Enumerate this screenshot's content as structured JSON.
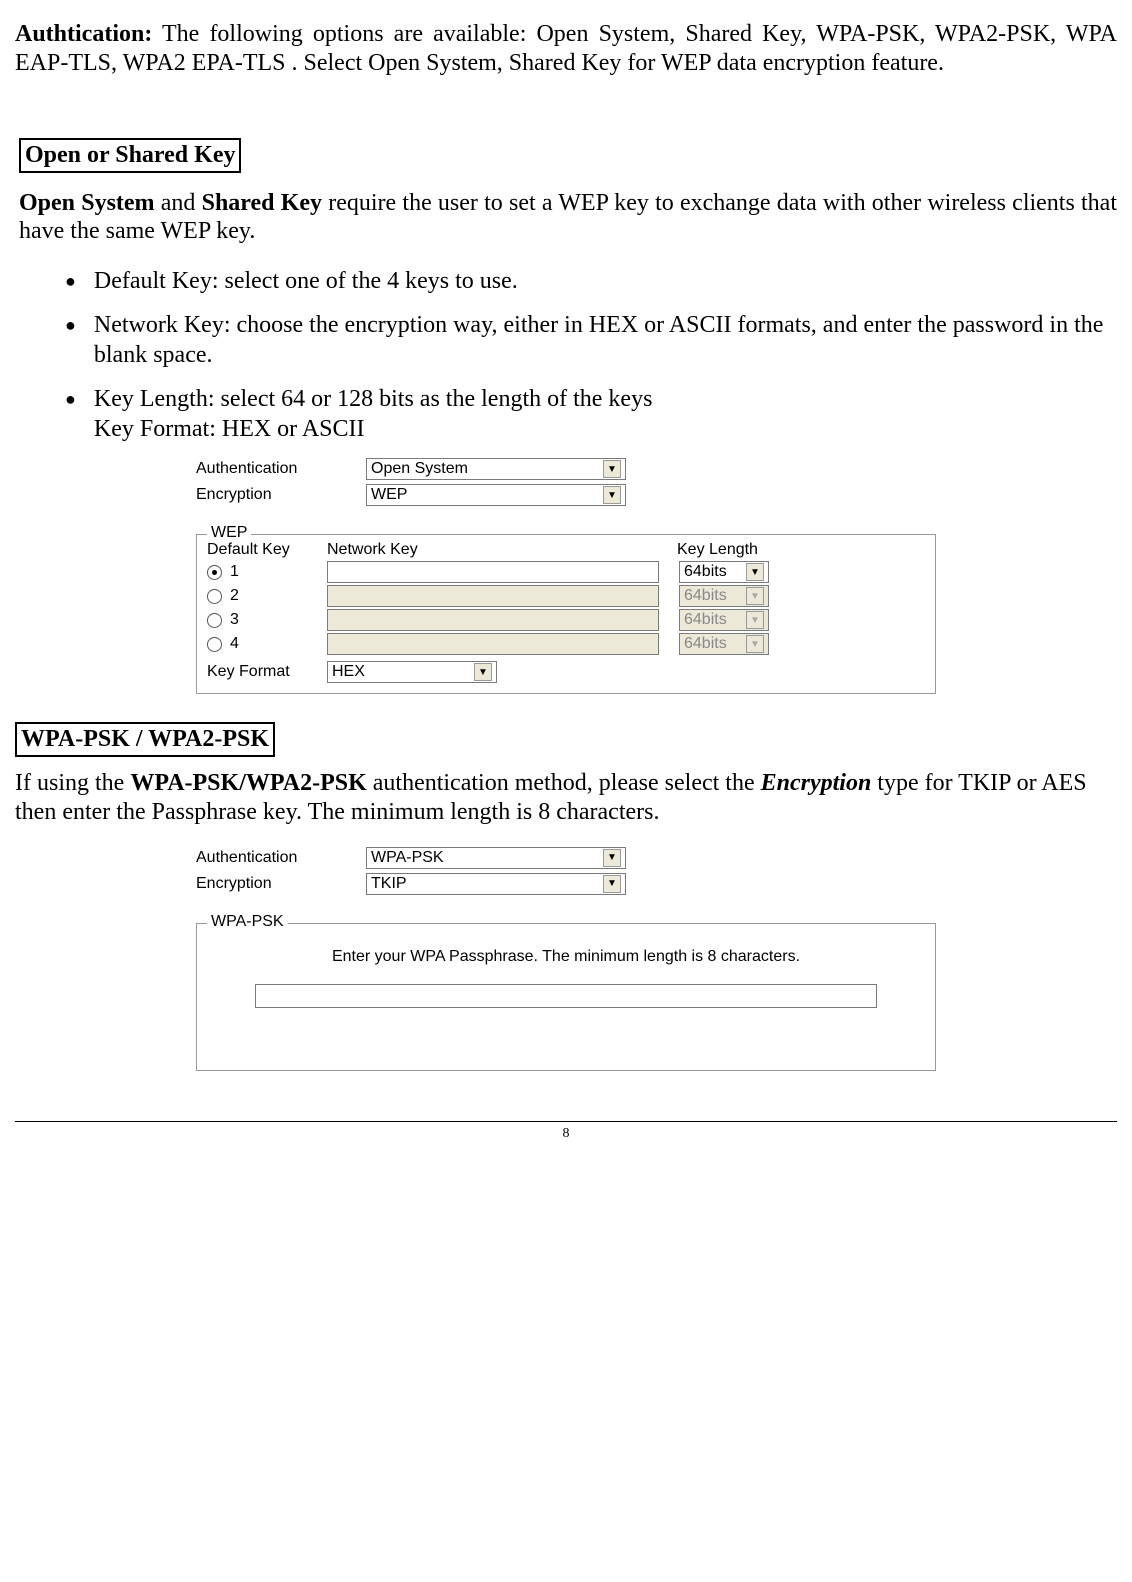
{
  "intro": {
    "label": "Authtication:",
    "text": " The following options are available: Open System, Shared Key, WPA-PSK, WPA2-PSK, WPA EAP-TLS, WPA2 EPA-TLS .  Select Open System, Shared Key for WEP data encryption feature."
  },
  "section1": {
    "heading": "Open or Shared Key",
    "para_b1": "Open System",
    "para_mid1": " and ",
    "para_b2": "Shared Key",
    "para_rest": " require the user to set a WEP key to exchange data with other wireless clients that have the same WEP key.",
    "bullets": [
      "Default Key: select one of the 4 keys to use.",
      "Network Key: choose the encryption way, either in HEX or ASCII formats, and enter the password in the blank space.",
      "Key Length: select 64 or 128 bits as the length of the keys\nKey Format: HEX or ASCII"
    ]
  },
  "ui1": {
    "auth_label": "Authentication",
    "auth_value": "Open System",
    "enc_label": "Encryption",
    "enc_value": "WEP",
    "wep_legend": "WEP",
    "col_defkey": "Default Key",
    "col_netkey": "Network Key",
    "col_keylen": "Key Length",
    "rows": [
      {
        "num": "1",
        "selected": true,
        "len": "64bits",
        "disabled": false
      },
      {
        "num": "2",
        "selected": false,
        "len": "64bits",
        "disabled": true
      },
      {
        "num": "3",
        "selected": false,
        "len": "64bits",
        "disabled": true
      },
      {
        "num": "4",
        "selected": false,
        "len": "64bits",
        "disabled": true
      }
    ],
    "keyfmt_label": "Key Format",
    "keyfmt_value": "HEX"
  },
  "section2": {
    "heading": "WPA-PSK / WPA2-PSK",
    "para_pre": "If using the ",
    "para_b1": "WPA-PSK/WPA2-PSK",
    "para_mid": " authentication method, please select the ",
    "para_i1": "Encryption",
    "para_rest": " type for TKIP or AES then enter the Passphrase key. The minimum length is 8 characters."
  },
  "ui2": {
    "auth_label": "Authentication",
    "auth_value": "WPA-PSK",
    "enc_label": "Encryption",
    "enc_value": "TKIP",
    "wpa_legend": "WPA-PSK",
    "wpa_hint": "Enter your WPA Passphrase.  The minimum length is 8 characters."
  },
  "page_number": "8"
}
